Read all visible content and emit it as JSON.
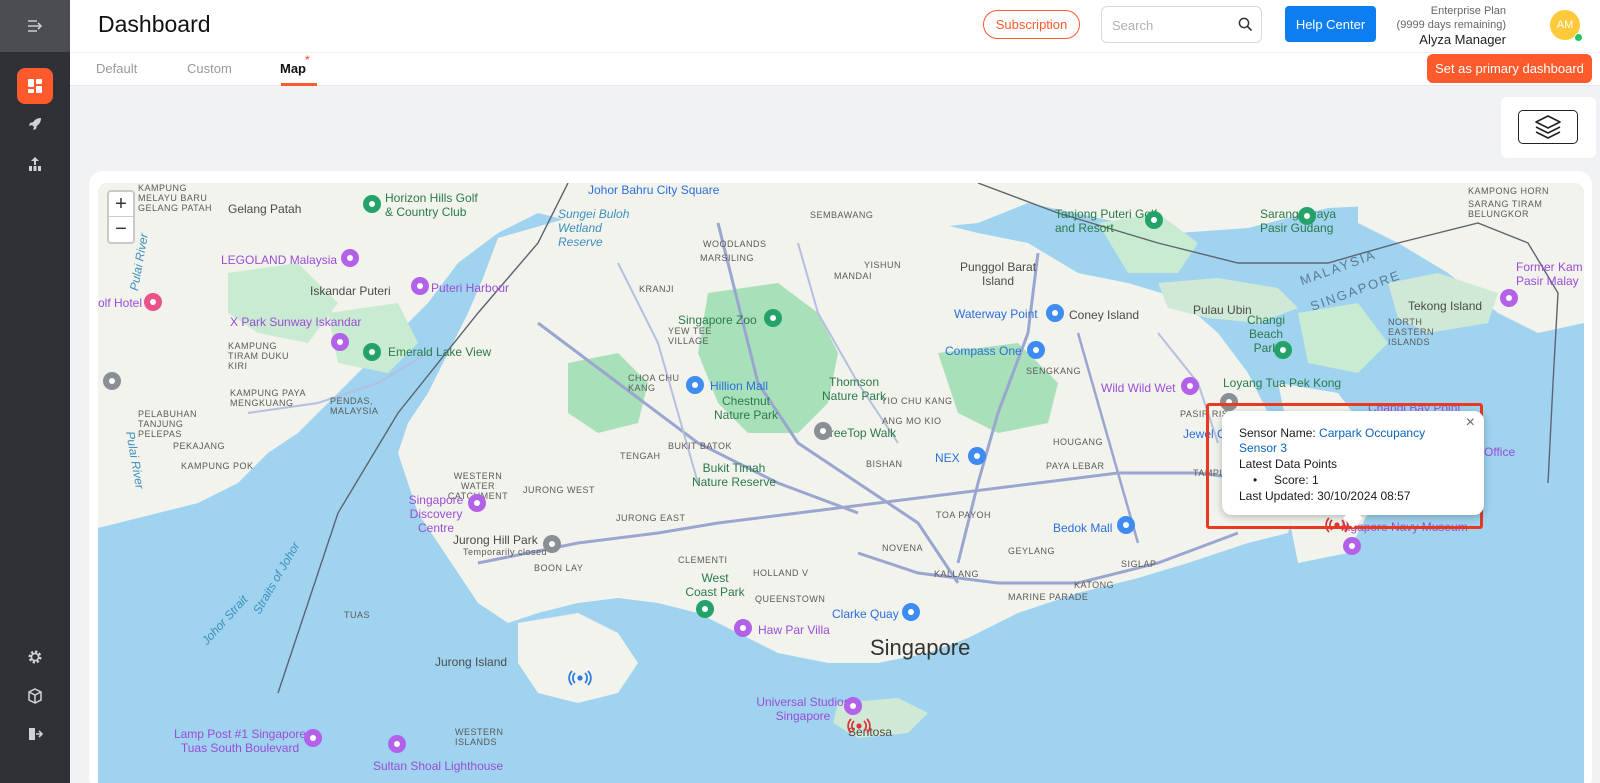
{
  "header": {
    "title": "Dashboard",
    "subscription_label": "Subscription",
    "search_placeholder": "Search",
    "help_label": "Help Center",
    "plan_name": "Enterprise Plan",
    "plan_remaining": "(9999 days remaining)",
    "user_name": "Alyza Manager",
    "avatar_initials": "AM"
  },
  "tabs": [
    {
      "label": "Default",
      "active": false
    },
    {
      "label": "Custom",
      "active": false
    },
    {
      "label": "Map",
      "active": true,
      "marker": "*"
    }
  ],
  "primary_button_label": "Set as primary dashboard",
  "map": {
    "zoom_in": "+",
    "zoom_out": "−",
    "labels": {
      "johor_bahru": "Johor Bahru City Square",
      "gelang_patah": "Gelang Patah",
      "horizon_hills": "Horizon Hills Golf & Country Club",
      "sungei_buloh": "Sungei Buloh Wetland Reserve",
      "sembawang": "SEMBAWANG",
      "tanjong_puteri": "Tanjong Puteri Golf and Resort",
      "sarang_buaya": "Sarang Buaya Pasir Gudang",
      "kampong_horn": "KAMPONG HORN",
      "legoland": "LEGOLAND Malaysia",
      "iskandar": "Iskandar Puteri",
      "puteri_harbour": "Puteri Harbour",
      "woodlands": "WOODLANDS",
      "marsiling": "MARSILING",
      "yishun": "YISHUN",
      "mandai": "MANDAI",
      "punggol": "Punggol Barat Island",
      "malaysia": "MALAYSIA",
      "singapore_border": "SINGAPORE",
      "former_kam": "Former Kam Pasir Malay",
      "golf_hotel": "olf Hotel",
      "x_park": "X Park Sunway Iskandar",
      "kranji": "KRANJI",
      "singapore_zoo": "Singapore Zoo",
      "waterway_point": "Waterway Point",
      "coney_island": "Coney Island",
      "pulau_ubin": "Pulau Ubin",
      "tekong": "Tekong Island",
      "emerald_lake": "Emerald Lake View",
      "compass_one": "Compass One",
      "changi_beach": "Changi Beach Park",
      "north_eastern": "NORTH EASTERN ISLANDS",
      "hillion": "Hillion Mall",
      "chestnut": "Chestnut Nature Park",
      "thomson": "Thomson Nature Park",
      "wild_wild_wet": "Wild Wild Wet",
      "loyang": "Loyang Tua Pek Kong",
      "changi_bay": "Changi Bay Point",
      "treetop": "TreeTop Walk",
      "jewel": "Jewel Ch",
      "pasir_ris": "PASIR RIS",
      "nex": "NEX",
      "hougang": "HOUGANG",
      "paya_lebar": "PAYA LEBAR",
      "bukit_timah": "Bukit Timah Nature Reserve",
      "tengah": "TENGAH",
      "bukit_batok": "BUKIT BATOK",
      "singapore_discovery": "Singapore Discovery Centre",
      "jurong_west": "JURONG WEST",
      "western_water": "WESTERN WATER CATCHMENT",
      "jurong_east": "JURONG EAST",
      "toa_payoh": "TOA PAYOH",
      "bishan": "BISHAN",
      "bedok_mall": "Bedok Mall",
      "tampines": "TAMPI",
      "navy_museum": "ingapore Navy Museum",
      "jurong_hill": "Jurong Hill Park",
      "temporarily_closed": "Temporarily closed",
      "boon_lay": "BOON LAY",
      "clementi": "CLEMENTI",
      "holland": "HOLLAND V",
      "novena": "NOVENA",
      "geylang": "GEYLANG",
      "kallang": "KALLANG",
      "siglap": "SIGLAP",
      "katong": "KATONG",
      "marine_parade": "MARINE PARADE",
      "west_coast": "West Coast Park",
      "queenstown": "QUEENSTOWN",
      "clarke_quay": "Clarke Quay",
      "tuas": "TUAS",
      "haw_par": "Haw Par Villa",
      "singapore": "Singapore",
      "jurong_island": "Jurong Island",
      "universal": "Universal Studios Singapore",
      "sentosa": "Sentosa",
      "lamp_post": "Lamp Post #1 Singapore Tuas South Boulevard",
      "western_islands": "WESTERN ISLANDS",
      "sultan_shoal": "Sultan Shoal Lighthouse",
      "johor_strait": "Johor Strait",
      "straits_johor": "Straits of Johor",
      "pulai_river": "Pulai River",
      "pulai_river2": "Pulai River",
      "kampung_tiram": "KAMPUNG TIRAM DUKU KIRI",
      "kampung_paya": "KAMPUNG PAYA MENGKUANG",
      "pendas": "PENDAS, MALAYSIA",
      "pelabuhan": "PELABUHAN TANJUNG PELEPAS",
      "pekajang": "PEKAJANG",
      "kampung_pok": "KAMPUNG POK",
      "kampung_melayu": "KAMPUNG MELAYU BARU GELANG PATAH",
      "yew_tee": "YEW TEE VILLAGE",
      "choa_chu_kang": "CHOA CHU KANG",
      "yio_chu_kang": "YIO CHU KANG",
      "ang_mo_kio": "ANG MO KIO",
      "sengkang": "SENGKANG",
      "sarang_tekong": "SARANG TIRAM BELUNGKOR",
      "office": "Office"
    }
  },
  "popup": {
    "sensor_label": "Sensor Name:",
    "sensor_name": "Carpark Occupancy Sensor 3",
    "latest_label": "Latest Data Points",
    "score": "Score: 1",
    "updated_label": "Last Updated:",
    "updated_value": "30/10/2024 08:57",
    "close": "×"
  },
  "colors": {
    "accent": "#ff5a2c",
    "help": "#0c7ef2",
    "water": "#9fd3ef",
    "land": "#f2f3ed",
    "park": "#a8e0b9",
    "sensor_blue": "#2a7de1",
    "sensor_red": "#e0343a"
  },
  "icons": {
    "sidebar_toggle": "menu-collapse-icon",
    "dashboard": "dashboard-icon",
    "rocket": "rocket-icon",
    "analytics": "analytics-icon",
    "settings": "gear-icon",
    "package": "cube-icon",
    "logout": "logout-icon",
    "search": "search-icon",
    "layers": "layers-icon"
  }
}
